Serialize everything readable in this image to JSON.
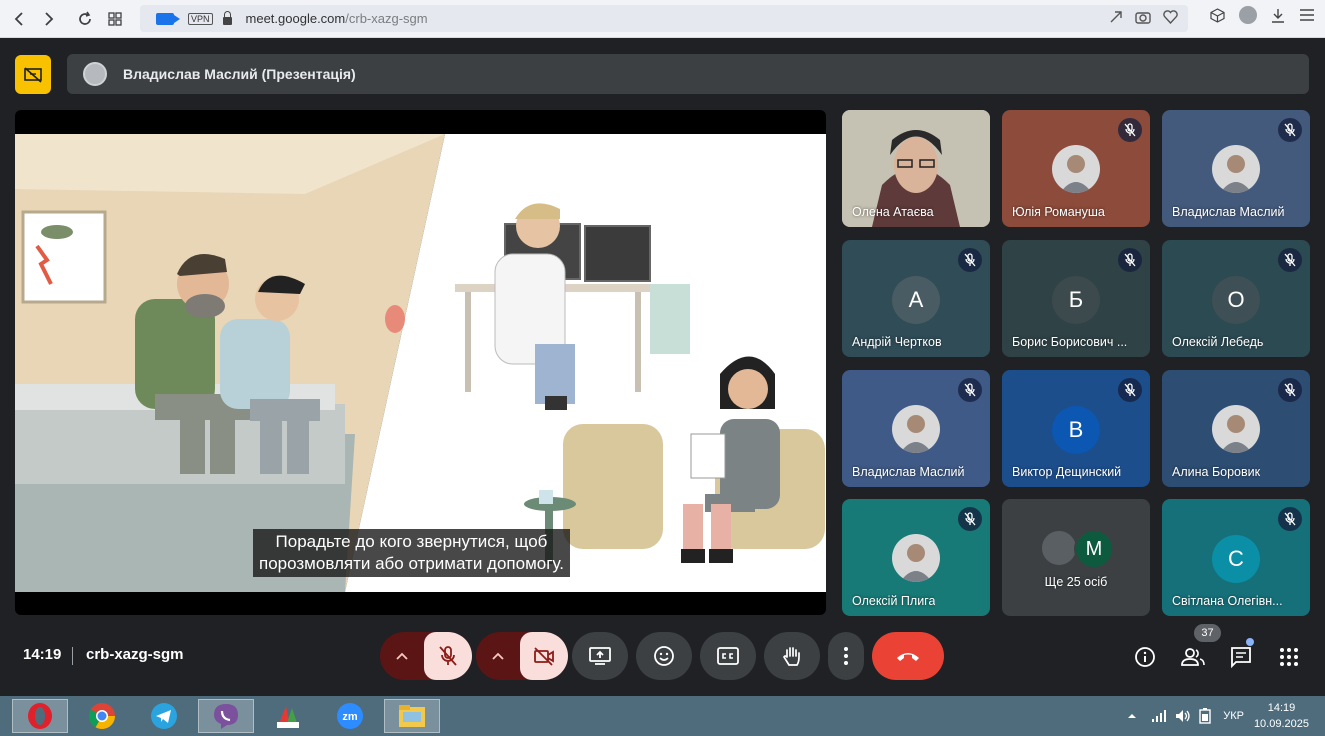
{
  "browser": {
    "url_host": "meet.google.com",
    "url_path": "/crb-xazg-sgm",
    "vpn_label": "VPN"
  },
  "presenter": {
    "name": "Владислав Маслий (Презентація)"
  },
  "slide": {
    "caption": "Порадьте до кого звернутися, щоб\nпорозмовляти або отримати допомогу."
  },
  "participants": [
    {
      "name": "Олена Атаєва",
      "muted": false,
      "kind": "video"
    },
    {
      "name": "Юлія Романуша",
      "muted": true,
      "kind": "photo"
    },
    {
      "name": "Владислав Маслий",
      "muted": true,
      "kind": "photo"
    },
    {
      "name": "Андрій Чертков",
      "muted": true,
      "kind": "initial",
      "initial": "А"
    },
    {
      "name": "Борис Борисович ...",
      "muted": true,
      "kind": "initial",
      "initial": "Б"
    },
    {
      "name": "Олексій Лебедь",
      "muted": true,
      "kind": "initial",
      "initial": "О"
    },
    {
      "name": "Владислав Маслий",
      "muted": true,
      "kind": "photo"
    },
    {
      "name": "Виктор Дещинский",
      "muted": true,
      "kind": "initial",
      "initial": "В"
    },
    {
      "name": "Алина Боровик",
      "muted": true,
      "kind": "photo"
    },
    {
      "name": "Олексій Плига",
      "muted": true,
      "kind": "photo"
    },
    {
      "name": "Ще 25 осіб",
      "muted": false,
      "kind": "more",
      "initial": "М"
    },
    {
      "name": "Світлана Олегівн...",
      "muted": true,
      "kind": "initial",
      "initial": "С"
    }
  ],
  "footer": {
    "time": "14:19",
    "meeting_code": "crb-xazg-sgm",
    "people_count": "37"
  },
  "taskbar": {
    "lang": "УКР",
    "clock_time": "14:19",
    "clock_date": "10.09.2025"
  },
  "colors": {
    "hangup": "#ea4335",
    "muted_bg": "#f9dedc",
    "present_accent": "#f9c200",
    "meet_bg": "#202124"
  }
}
